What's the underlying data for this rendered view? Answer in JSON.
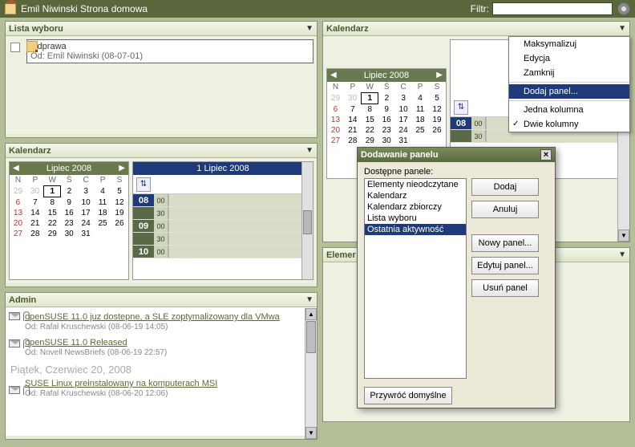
{
  "topbar": {
    "title": "Emil Niwinski Strona domowa",
    "filter_label": "Filtr:",
    "filter_value": ""
  },
  "lista": {
    "title": "Lista wyboru",
    "item": {
      "subject": "Odprawa",
      "from": "Od: Emil Niwinski (08-07-01)"
    }
  },
  "left_cal": {
    "title": "Kalendarz",
    "month_label": "Lipiec 2008",
    "day_head": "1 Lipiec 2008",
    "dow": [
      "N",
      "P",
      "W",
      "Ś",
      "C",
      "P",
      "S"
    ],
    "weeks": [
      [
        {
          "d": 29,
          "o": 1
        },
        {
          "d": 30,
          "o": 1
        },
        {
          "d": 1,
          "sel": 1
        },
        {
          "d": 2
        },
        {
          "d": 3
        },
        {
          "d": 4
        },
        {
          "d": 5
        }
      ],
      [
        {
          "d": 6,
          "sun": 1
        },
        {
          "d": 7
        },
        {
          "d": 8
        },
        {
          "d": 9
        },
        {
          "d": 10
        },
        {
          "d": 11
        },
        {
          "d": 12
        }
      ],
      [
        {
          "d": 13,
          "sun": 1
        },
        {
          "d": 14
        },
        {
          "d": 15
        },
        {
          "d": 16
        },
        {
          "d": 17
        },
        {
          "d": 18
        },
        {
          "d": 19
        }
      ],
      [
        {
          "d": 20,
          "sun": 1
        },
        {
          "d": 21
        },
        {
          "d": 22
        },
        {
          "d": 23
        },
        {
          "d": 24
        },
        {
          "d": 25
        },
        {
          "d": 26
        }
      ],
      [
        {
          "d": 27,
          "sun": 1
        },
        {
          "d": 28
        },
        {
          "d": 29
        },
        {
          "d": 30
        },
        {
          "d": 31
        },
        {
          "d": ""
        },
        {
          "d": ""
        }
      ]
    ],
    "hours": [
      {
        "h": "08",
        "m": "00",
        "now": 1
      },
      {
        "h": "",
        "m": "30"
      },
      {
        "h": "09",
        "m": "00"
      },
      {
        "h": "",
        "m": "30"
      },
      {
        "h": "10",
        "m": "00"
      }
    ]
  },
  "admin": {
    "title": "Admin",
    "msgs": [
      {
        "subject": "openSUSE 11.0 juz dostepne, a SLE zoptymalizowany dla VMwa",
        "from": "Od: Rafal Kruschewski (08-06-19 14:05)"
      },
      {
        "subject": "openSUSE 11.0 Released",
        "from": "Od: Novell NewsBriefs (08-06-19 22:57)"
      }
    ],
    "sep": "Piątek, Czerwiec 20, 2008",
    "msgs2": [
      {
        "subject": "SUSE Linux preinstalowany na komputerach MSI",
        "from": "Od: Rafal Kruschewski (08-06-20 12:06)"
      }
    ]
  },
  "right_cal": {
    "title": "Kalendarz",
    "month_label": "Lipiec 2008",
    "right_hours": [
      {
        "h": "08",
        "m": "00",
        "now": 1
      },
      {
        "h": "",
        "m": "30"
      }
    ]
  },
  "elem": {
    "title": "Elemer"
  },
  "ctx": {
    "items": [
      {
        "label": "Maksymalizuj"
      },
      {
        "label": "Edycja"
      },
      {
        "label": "Zamknij"
      },
      {
        "sep": 1
      },
      {
        "label": "Dodaj panel...",
        "sel": 1
      },
      {
        "sep": 1
      },
      {
        "label": "Jedna kolumna"
      },
      {
        "label": "Dwie kolumny",
        "chk": 1
      }
    ]
  },
  "dialog": {
    "title": "Dodawanie panelu",
    "avail_label": "Dostępne panele:",
    "items": [
      {
        "label": "Elementy nieodczytane"
      },
      {
        "label": "Kalendarz"
      },
      {
        "label": "Kalendarz zbiorczy"
      },
      {
        "label": "Lista wyboru"
      },
      {
        "label": "Ostatnia aktywność",
        "sel": 1
      }
    ],
    "btns": {
      "add": "Dodaj",
      "cancel": "Anuluj",
      "new": "Nowy panel...",
      "edit": "Edytuj panel...",
      "del": "Usuń panel",
      "restore": "Przywróć domyślne"
    }
  }
}
